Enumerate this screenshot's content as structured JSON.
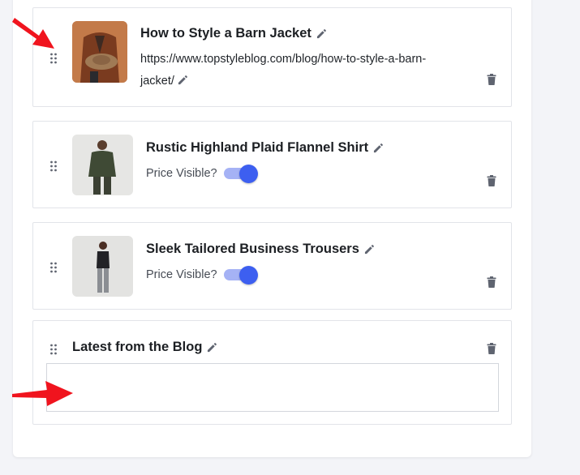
{
  "blocks": {
    "blog_post": {
      "title": "How to Style a Barn Jacket",
      "url_line1": "https://www.topstyleblog.com/blog/how-to-style-a-barn-",
      "url_line2": "jacket/"
    },
    "product_1": {
      "title": "Rustic Highland Plaid Flannel Shirt",
      "price_label": "Price Visible?",
      "price_visible": true
    },
    "product_2": {
      "title": "Sleek Tailored Business Trousers",
      "price_label": "Price Visible?",
      "price_visible": true
    },
    "blog_section": {
      "title": "Latest from the Blog",
      "content": ""
    }
  },
  "colors": {
    "accent": "#3d5ff0",
    "accent_track": "#a5b2f5",
    "icon": "#5f6470",
    "annotation_arrow": "#f0141e"
  },
  "icons": {
    "drag": "drag-handle-icon",
    "edit": "pencil-icon",
    "delete": "trash-icon"
  }
}
